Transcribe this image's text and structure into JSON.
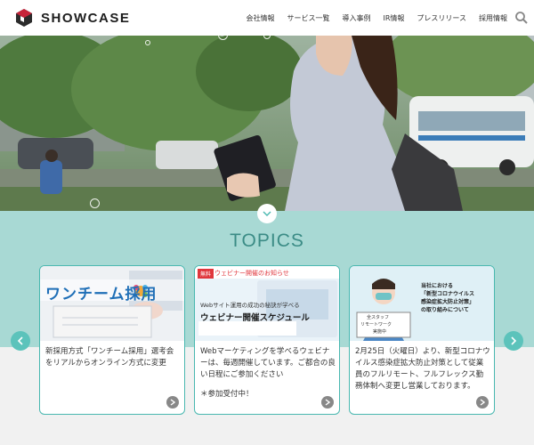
{
  "brand": {
    "name": "SHOWCASE"
  },
  "nav": [
    {
      "label": "会社情報"
    },
    {
      "label": "サービス一覧"
    },
    {
      "label": "導入事例"
    },
    {
      "label": "IR情報"
    },
    {
      "label": "プレスリリース"
    },
    {
      "label": "採用情報"
    }
  ],
  "colors": {
    "accent": "#49b8b0",
    "section_bg": "#a8d9d4",
    "title": "#3b8c86",
    "logo_red": "#c7243a"
  },
  "topics": {
    "title": "TOPICS",
    "cards": [
      {
        "image_text": "ワンチーム採用",
        "body": "新採用方式「ワンチーム採用」選考会をリアルからオンライン方式に変更",
        "note": ""
      },
      {
        "image_badge": "無料",
        "image_header": "ウェビナー開催のお知らせ",
        "image_sub": "Webサイト運用の成功の秘訣が学べる",
        "image_text": "ウェビナー開催スケジュール",
        "body": "Webマーケティングを学べるウェビナーは、毎週開催しています。ご都合の良い日程にご参加ください",
        "note": "＊参加受付中！"
      },
      {
        "image_sign_1": "全スタッフ",
        "image_sign_2": "リモートワーク",
        "image_sign_3": "実施中",
        "image_caption_1": "当社における",
        "image_caption_2": "「新型コロナウイルス",
        "image_caption_3": "感染症拡大防止対策」",
        "image_caption_4": "の取り組みについて",
        "body": "2月25日（火曜日）より、新型コロナウイルス感染症拡大防止対策として従業員のフルリモート、フルフレックス勤務体制へ変更し営業しております。",
        "note": ""
      }
    ]
  }
}
